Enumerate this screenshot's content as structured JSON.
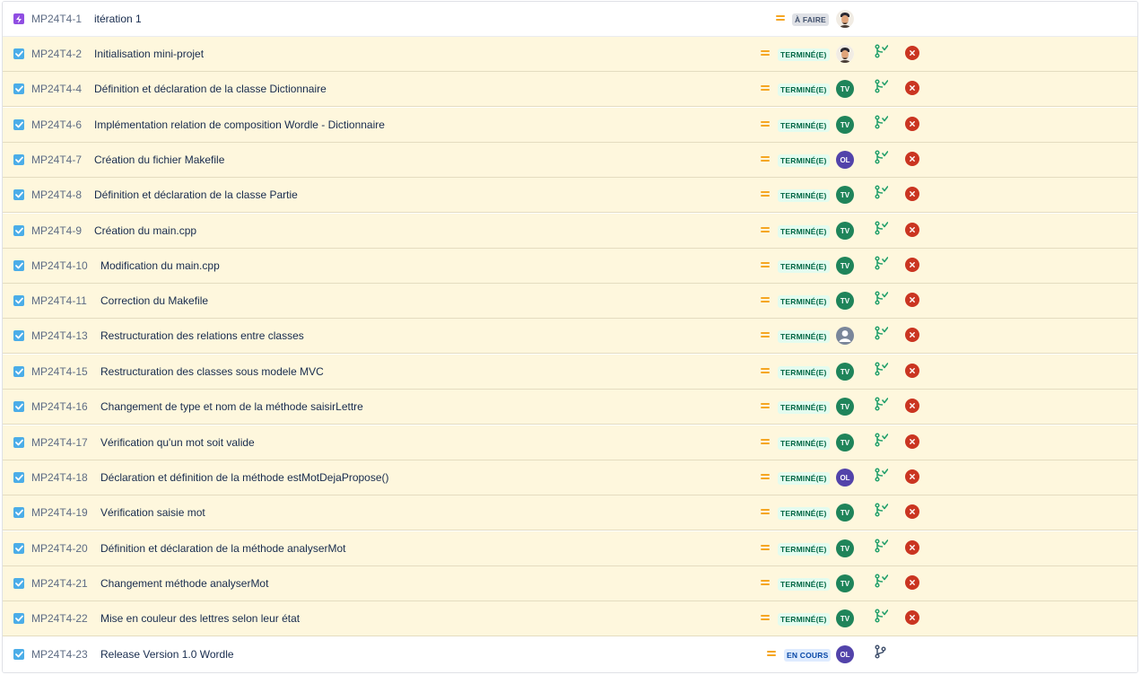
{
  "colors": {
    "priority": "#f5a623",
    "branch_merged": "#22a06b",
    "branch_open": "#42526e",
    "remove": "#ca3521",
    "task_icon": "#4bade8",
    "epic_icon": "#904ee2",
    "row_highlight": "#fef7dd"
  },
  "issues": [
    {
      "key": "MP24T4-1",
      "summary": "itération 1",
      "type": "epic-icon",
      "priority": "medium-priority-icon",
      "status": "À FAIRE",
      "status_kind": "todo",
      "assignee": "avatar-photo",
      "dev": "",
      "removable": false
    },
    {
      "key": "MP24T4-2",
      "summary": "Initialisation mini-projet",
      "type": "checkbox-task-icon",
      "priority": "medium-priority-icon",
      "status": "TERMINÉ(E)",
      "status_kind": "done",
      "assignee": "avatar-photo",
      "dev": "branch-merged-icon",
      "removable": true
    },
    {
      "key": "MP24T4-4",
      "summary": "Définition et déclaration de la classe Dictionnaire",
      "type": "checkbox-task-icon",
      "priority": "medium-priority-icon",
      "status": "TERMINÉ(E)",
      "status_kind": "done",
      "assignee": "TV",
      "dev": "branch-merged-icon",
      "removable": true
    },
    {
      "key": "MP24T4-6",
      "summary": "Implémentation relation de composition Wordle - Dictionnaire",
      "type": "checkbox-task-icon",
      "priority": "medium-priority-icon",
      "status": "TERMINÉ(E)",
      "status_kind": "done",
      "assignee": "TV",
      "dev": "branch-merged-icon",
      "removable": true
    },
    {
      "key": "MP24T4-7",
      "summary": "Création du fichier Makefile",
      "type": "checkbox-task-icon",
      "priority": "medium-priority-icon",
      "status": "TERMINÉ(E)",
      "status_kind": "done",
      "assignee": "OL",
      "dev": "branch-merged-icon",
      "removable": true
    },
    {
      "key": "MP24T4-8",
      "summary": "Définition et déclaration de la classe Partie",
      "type": "checkbox-task-icon",
      "priority": "medium-priority-icon",
      "status": "TERMINÉ(E)",
      "status_kind": "done",
      "assignee": "TV",
      "dev": "branch-merged-icon",
      "removable": true
    },
    {
      "key": "MP24T4-9",
      "summary": "Création du main.cpp",
      "type": "checkbox-task-icon",
      "priority": "medium-priority-icon",
      "status": "TERMINÉ(E)",
      "status_kind": "done",
      "assignee": "TV",
      "dev": "branch-merged-icon",
      "removable": true
    },
    {
      "key": "MP24T4-10",
      "summary": "Modification du main.cpp",
      "type": "checkbox-task-icon",
      "priority": "medium-priority-icon",
      "status": "TERMINÉ(E)",
      "status_kind": "done",
      "assignee": "TV",
      "dev": "branch-merged-icon",
      "removable": true
    },
    {
      "key": "MP24T4-11",
      "summary": "Correction du Makefile",
      "type": "checkbox-task-icon",
      "priority": "medium-priority-icon",
      "status": "TERMINÉ(E)",
      "status_kind": "done",
      "assignee": "TV",
      "dev": "branch-merged-icon",
      "removable": true
    },
    {
      "key": "MP24T4-13",
      "summary": "Restructuration des relations entre classes",
      "type": "checkbox-task-icon",
      "priority": "medium-priority-icon",
      "status": "TERMINÉ(E)",
      "status_kind": "done",
      "assignee": "avatar-unassigned",
      "dev": "branch-merged-icon",
      "removable": true
    },
    {
      "key": "MP24T4-15",
      "summary": "Restructuration des classes sous modele MVC",
      "type": "checkbox-task-icon",
      "priority": "medium-priority-icon",
      "status": "TERMINÉ(E)",
      "status_kind": "done",
      "assignee": "TV",
      "dev": "branch-merged-icon",
      "removable": true
    },
    {
      "key": "MP24T4-16",
      "summary": "Changement de type et nom de la méthode saisirLettre",
      "type": "checkbox-task-icon",
      "priority": "medium-priority-icon",
      "status": "TERMINÉ(E)",
      "status_kind": "done",
      "assignee": "TV",
      "dev": "branch-merged-icon",
      "removable": true
    },
    {
      "key": "MP24T4-17",
      "summary": "Vérification qu'un mot soit valide",
      "type": "checkbox-task-icon",
      "priority": "medium-priority-icon",
      "status": "TERMINÉ(E)",
      "status_kind": "done",
      "assignee": "TV",
      "dev": "branch-merged-icon",
      "removable": true
    },
    {
      "key": "MP24T4-18",
      "summary": "Déclaration et définition de la méthode estMotDejaPropose()",
      "type": "checkbox-task-icon",
      "priority": "medium-priority-icon",
      "status": "TERMINÉ(E)",
      "status_kind": "done",
      "assignee": "OL",
      "dev": "branch-merged-icon",
      "removable": true
    },
    {
      "key": "MP24T4-19",
      "summary": "Vérification saisie mot",
      "type": "checkbox-task-icon",
      "priority": "medium-priority-icon",
      "status": "TERMINÉ(E)",
      "status_kind": "done",
      "assignee": "TV",
      "dev": "branch-merged-icon",
      "removable": true
    },
    {
      "key": "MP24T4-20",
      "summary": "Définition et déclaration de la méthode analyserMot",
      "type": "checkbox-task-icon",
      "priority": "medium-priority-icon",
      "status": "TERMINÉ(E)",
      "status_kind": "done",
      "assignee": "TV",
      "dev": "branch-merged-icon",
      "removable": true
    },
    {
      "key": "MP24T4-21",
      "summary": "Changement méthode analyserMot",
      "type": "checkbox-task-icon",
      "priority": "medium-priority-icon",
      "status": "TERMINÉ(E)",
      "status_kind": "done",
      "assignee": "TV",
      "dev": "branch-merged-icon",
      "removable": true
    },
    {
      "key": "MP24T4-22",
      "summary": "Mise en couleur des lettres selon leur état",
      "type": "checkbox-task-icon",
      "priority": "medium-priority-icon",
      "status": "TERMINÉ(E)",
      "status_kind": "done",
      "assignee": "TV",
      "dev": "branch-merged-icon",
      "removable": true
    },
    {
      "key": "MP24T4-23",
      "summary": "Release Version 1.0 Wordle",
      "type": "checkbox-task-icon",
      "priority": "medium-priority-icon",
      "status": "EN COURS",
      "status_kind": "inprogress",
      "assignee": "OL",
      "dev": "branch-open-icon",
      "removable": false
    }
  ]
}
